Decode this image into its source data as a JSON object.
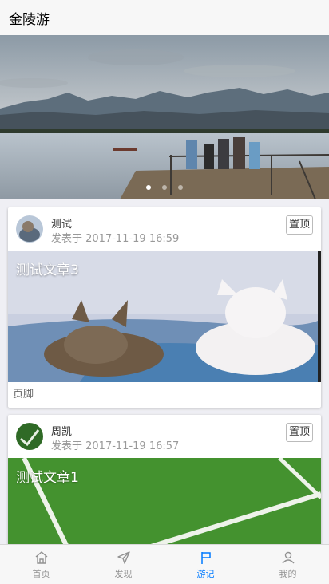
{
  "header": {
    "title": "金陵游"
  },
  "carousel": {
    "slide_count": 3,
    "active_index": 0
  },
  "posts": [
    {
      "author": "测试",
      "date": "发表于 2017-11-19 16:59",
      "pin_label": "置顶",
      "title": "测试文章3",
      "footer": "页脚",
      "image": "two-kittens-photo"
    },
    {
      "author": "周凯",
      "date": "发表于 2017-11-19 16:57",
      "pin_label": "置顶",
      "title": "测试文章1",
      "image": "soccer-field-photo"
    }
  ],
  "tabbar": {
    "items": [
      {
        "label": "首页",
        "icon": "home-icon"
      },
      {
        "label": "发现",
        "icon": "send-icon"
      },
      {
        "label": "游记",
        "icon": "flag-icon"
      },
      {
        "label": "我的",
        "icon": "user-icon"
      }
    ],
    "active_index": 2,
    "active_color": "#007aff",
    "inactive_color": "#929292"
  }
}
